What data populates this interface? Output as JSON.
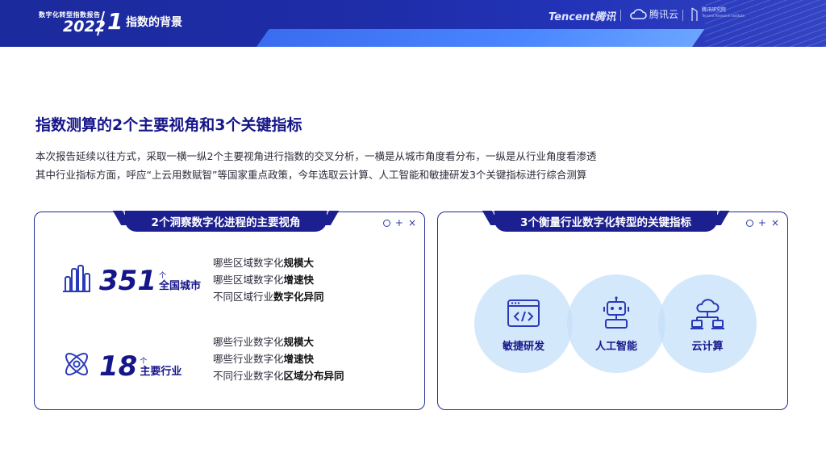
{
  "header": {
    "report_subtitle": "数字化转型指数报告",
    "report_year": "2022",
    "section_number": "1",
    "section_title": "指数的背景",
    "brand_tencent": "Tencent腾讯",
    "brand_cloud": "腾讯云",
    "brand_institute": "腾讯研究院",
    "brand_institute_en": "Tencent Research Institute"
  },
  "main": {
    "title": "指数测算的2个主要视角和3个关键指标",
    "intro_lines": [
      "本次报告延续以往方式，采取一横一纵2个主要视角进行指数的交叉分析，一横是从城市角度看分布，一纵是从行业角度看渗透",
      "其中行业指标方面，呼应“上云用数赋智”等国家重点政策，今年选取云计算、人工智能和敏捷研发3个关键指标进行综合测算"
    ]
  },
  "left_panel": {
    "tab_title": "2个洞察数字化进程的主要视角",
    "stats": [
      {
        "number": "351",
        "unit": "个",
        "label": "全国城市",
        "icon": "city-buildings-icon",
        "points": [
          {
            "prefix": "哪些区域数字化",
            "bold": "规模大"
          },
          {
            "prefix": "哪些区域数字化",
            "bold": "增速快"
          },
          {
            "prefix": "不同区域行业",
            "bold": "数字化异同"
          }
        ]
      },
      {
        "number": "18",
        "unit": "个",
        "label": "主要行业",
        "icon": "atom-icon",
        "points": [
          {
            "prefix": "哪些行业数字化",
            "bold": "规模大"
          },
          {
            "prefix": "哪些行业数字化",
            "bold": "增速快"
          },
          {
            "prefix": "不同行业数字化",
            "bold": "区域分布异同"
          }
        ]
      }
    ]
  },
  "right_panel": {
    "tab_title": "3个衡量行业数字化转型的关键指标",
    "indicators": [
      {
        "label": "敏捷研发",
        "icon": "code-window-icon"
      },
      {
        "label": "人工智能",
        "icon": "robot-icon"
      },
      {
        "label": "云计算",
        "icon": "cloud-network-icon"
      }
    ]
  },
  "window_controls": {
    "circle": "○",
    "plus": "+",
    "close": "×"
  },
  "colors": {
    "primary_navy": "#16168a",
    "header_blue": "#1e2da8",
    "accent_blue": "#3a6cf0",
    "circle_fill": "#c6e0fa"
  }
}
